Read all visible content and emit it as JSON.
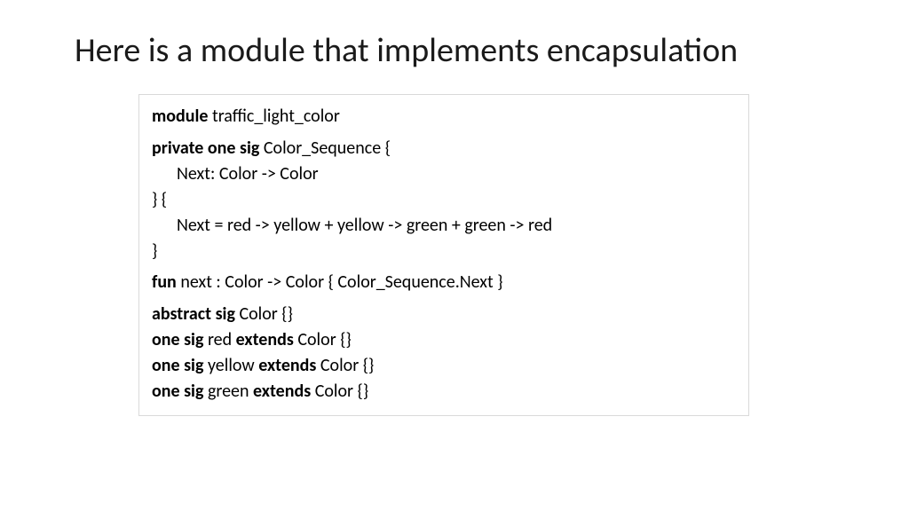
{
  "title": "Here is a module that implements encapsulation",
  "code": {
    "l1_kw": "module",
    "l1_rest": " traffic_light_color",
    "l2_kw": "private one sig",
    "l2_rest": " Color_Sequence {",
    "l3": "Next: Color -> Color",
    "l4": "} {",
    "l5": "Next = red -> yellow + yellow -> green + green -> red",
    "l6": "}",
    "l7_kw": "fun",
    "l7_rest": " next : Color -> Color { Color_Sequence.Next }",
    "l8_kw": "abstract sig",
    "l8_rest": " Color {}",
    "l9_kw1": "one sig",
    "l9_mid": " red ",
    "l9_kw2": "extends",
    "l9_end": " Color {}",
    "l10_mid": " yellow ",
    "l11_mid": " green "
  }
}
